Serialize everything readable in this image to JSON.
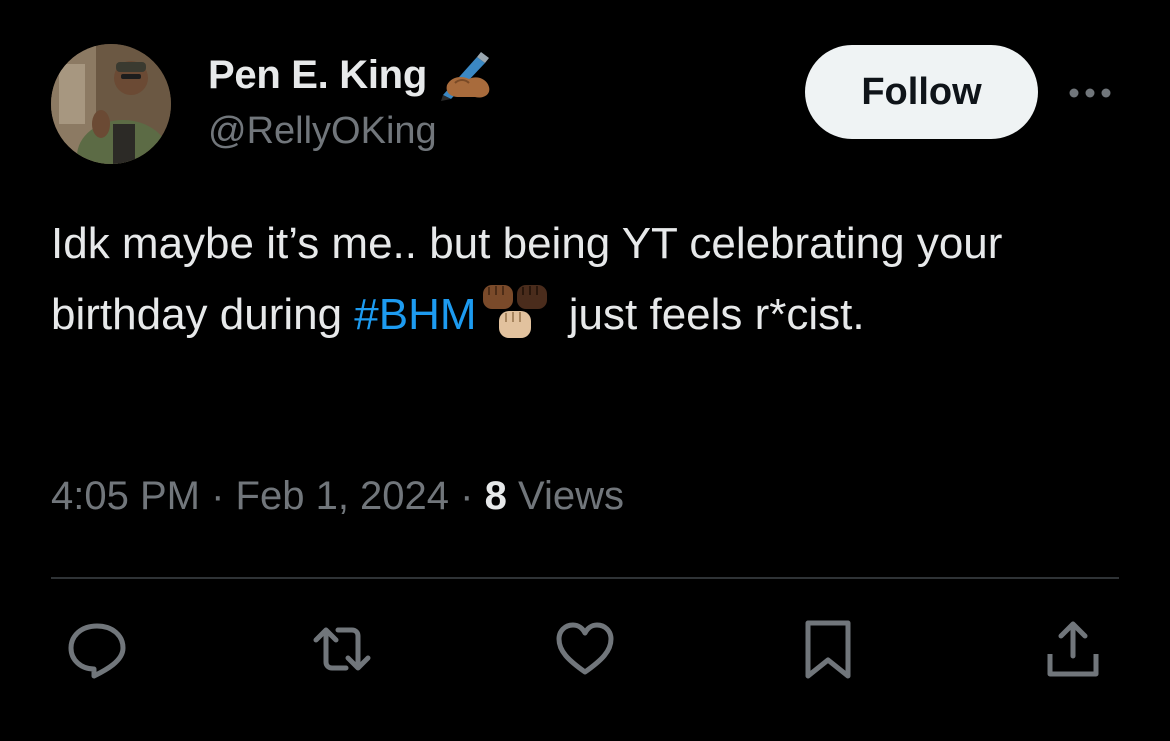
{
  "author": {
    "display_name": "Pen E. King",
    "name_emoji": "writing-hand-emoji",
    "handle": "@RellyOKing"
  },
  "follow_button": {
    "label": "Follow"
  },
  "more_menu": {
    "icon": "more-horizontal-icon"
  },
  "tweet": {
    "text_part1": "Idk maybe it’s me.. but being YT celebrating your birthday during ",
    "hashtag": "#BHM",
    "inline_emoji": "raised-fists-emoji",
    "text_part2": " just feels r*cist."
  },
  "meta": {
    "time": "4:05 PM",
    "separator": "·",
    "date": "Feb 1, 2024",
    "views_count": "8",
    "views_label": "Views"
  },
  "actions": [
    {
      "icon": "reply-icon"
    },
    {
      "icon": "retweet-icon"
    },
    {
      "icon": "like-icon"
    },
    {
      "icon": "bookmark-icon"
    },
    {
      "icon": "share-icon"
    }
  ],
  "colors": {
    "background": "#000000",
    "primary_text": "#e7e9ea",
    "secondary_text": "#71767b",
    "link": "#1d9bf0",
    "follow_bg": "#eff3f4",
    "divider": "#2f3336"
  }
}
